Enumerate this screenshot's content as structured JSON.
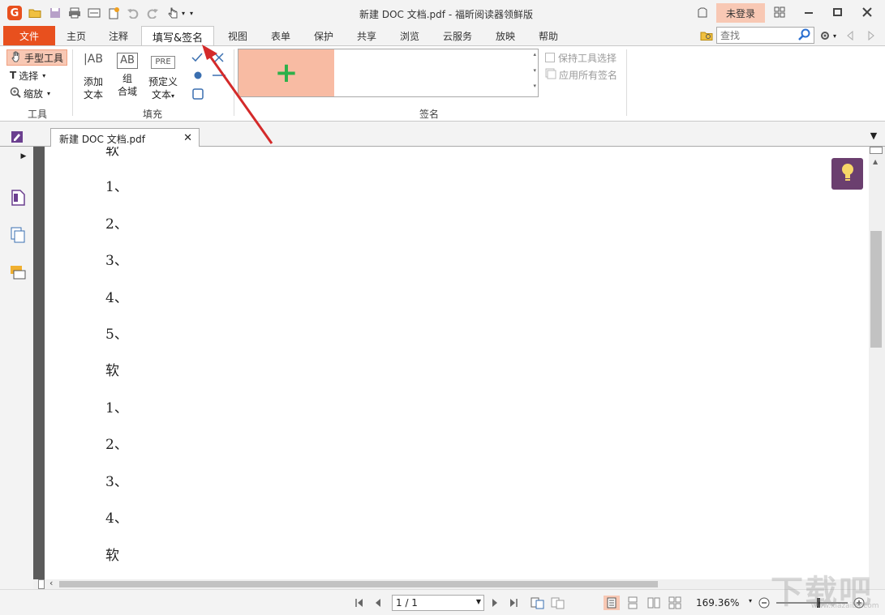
{
  "titlebar": {
    "app_logo": "G",
    "title": "新建 DOC 文档.pdf - 福昕阅读器领鲜版",
    "login": "未登录"
  },
  "tabs": {
    "file": "文件",
    "items": [
      "主页",
      "注释",
      "填写&签名",
      "视图",
      "表单",
      "保护",
      "共享",
      "浏览",
      "云服务",
      "放映",
      "帮助"
    ],
    "active": "填写&签名"
  },
  "search": {
    "placeholder": "查找"
  },
  "ribbon": {
    "tools": {
      "hand": "手型工具",
      "select": "选择",
      "zoom": "缩放",
      "group_label": "工具"
    },
    "fill": {
      "add_text_line1": "添加",
      "add_text_line2": "文本",
      "comb_line1": "组",
      "comb_line2": "合域",
      "predefined_line1": "预定义",
      "predefined_line2": "文本",
      "add_text_icon": "AB",
      "comb_icon": "AB",
      "predefined_icon": "PRE",
      "group_label": "填充"
    },
    "sign": {
      "group_label": "签名",
      "keep_tool": "保持工具选择",
      "apply_all": "应用所有签名"
    }
  },
  "document": {
    "tab_title": "新建 DOC 文档.pdf",
    "lines": [
      "软",
      "1、",
      "2、",
      "3、",
      "4、",
      "5、",
      "软",
      "1、",
      "2、",
      "3、",
      "4、",
      "软"
    ]
  },
  "statusbar": {
    "page": "1 / 1",
    "zoom": "169.36%"
  },
  "watermark": {
    "main": "下载吧",
    "sub": "www.xiazaiba.com"
  },
  "colors": {
    "accent": "#e8501e",
    "highlight": "#f8c8b4",
    "sig_add": "#f8bba3",
    "plus": "#2db04a",
    "bulb_bg": "#6b3f6f",
    "arrow": "#d42a2a"
  }
}
